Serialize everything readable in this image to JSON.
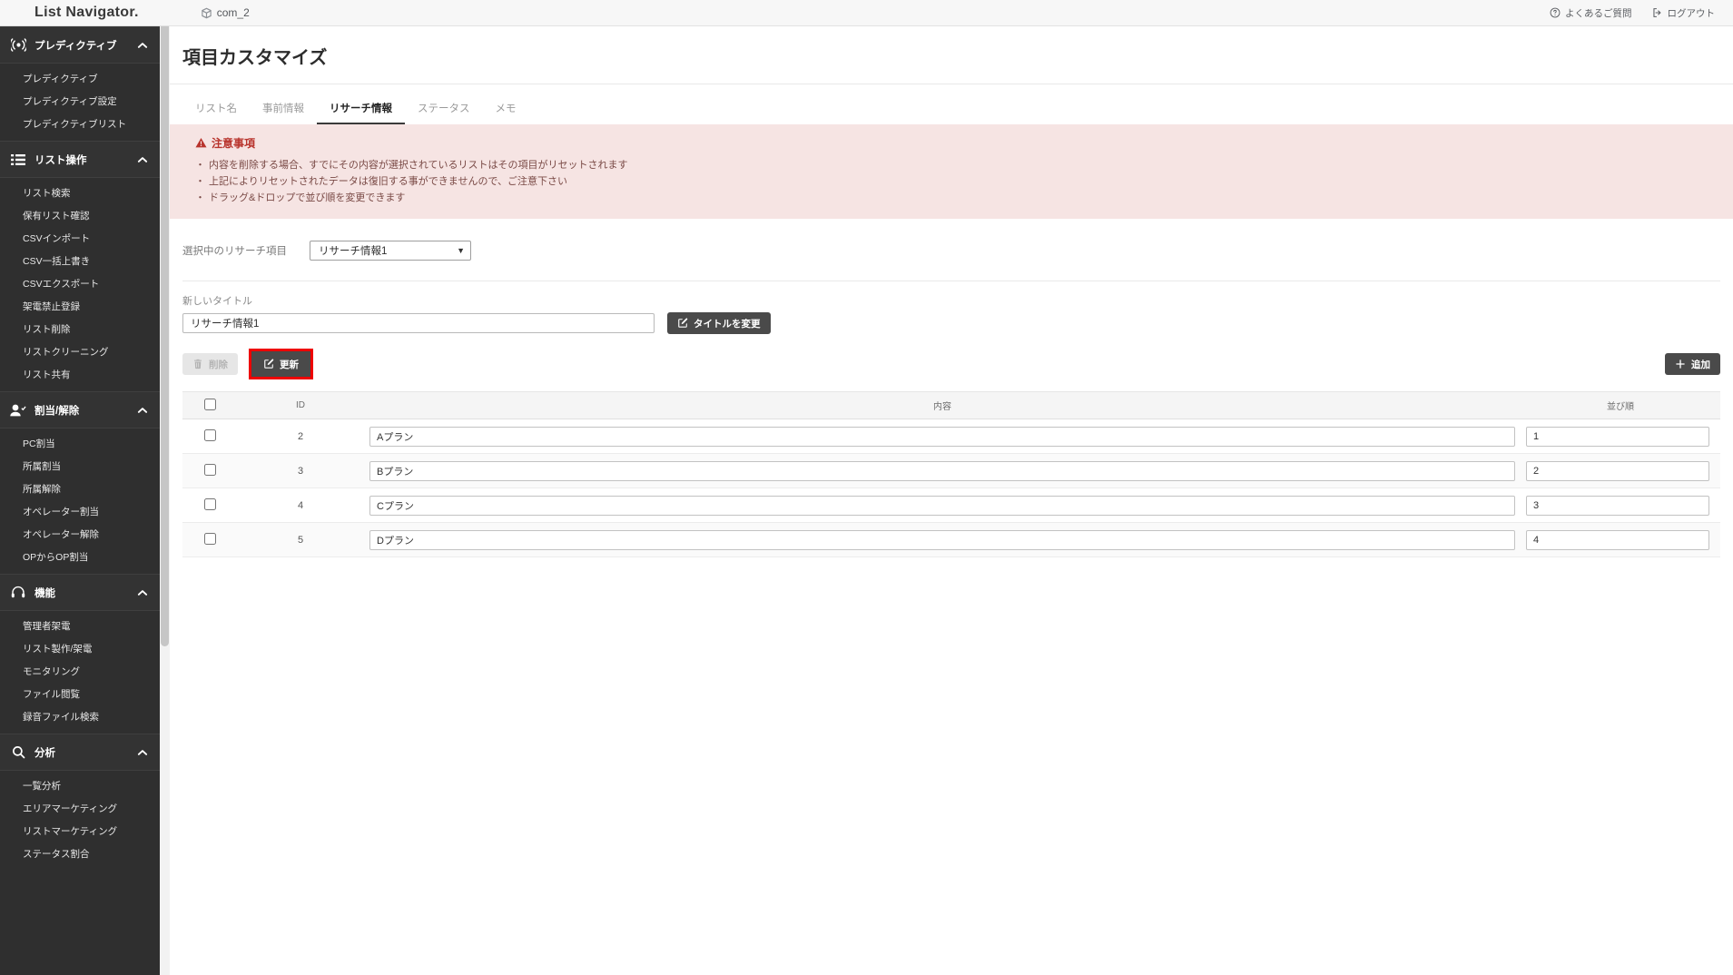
{
  "topbar": {
    "brand": "List Navigator.",
    "company": "com_2",
    "company_icon": "cube-icon",
    "links": [
      {
        "label": "よくあるご質問",
        "icon": "question-circle-icon"
      },
      {
        "label": "ログアウト",
        "icon": "logout-icon"
      }
    ]
  },
  "sidebar": {
    "groups": [
      {
        "label": "プレディクティブ",
        "icon": "broadcast-icon",
        "chevron": "chevron-up-icon",
        "items": [
          "プレディクティブ",
          "プレディクティブ設定",
          "プレディクティブリスト"
        ]
      },
      {
        "label": "リスト操作",
        "icon": "list-icon",
        "chevron": "chevron-up-icon",
        "items": [
          "リスト検索",
          "保有リスト確認",
          "CSVインポート",
          "CSV一括上書き",
          "CSVエクスポート",
          "架電禁止登録",
          "リスト削除",
          "リストクリーニング",
          "リスト共有"
        ]
      },
      {
        "label": "割当/解除",
        "icon": "user-check-icon",
        "chevron": "chevron-up-icon",
        "items": [
          "PC割当",
          "所属割当",
          "所属解除",
          "オペレーター割当",
          "オペレーター解除",
          "OPからOP割当"
        ]
      },
      {
        "label": "機能",
        "icon": "headset-icon",
        "chevron": "chevron-up-icon",
        "items": [
          "管理者架電",
          "リスト製作/架電",
          "モニタリング",
          "ファイル閲覧",
          "録音ファイル検索"
        ]
      },
      {
        "label": "分析",
        "icon": "search-icon",
        "chevron": "chevron-up-icon",
        "items": [
          "一覧分析",
          "エリアマーケティング",
          "リストマーケティング",
          "ステータス割合"
        ]
      }
    ]
  },
  "main": {
    "page_title": "項目カスタマイズ",
    "tabs": [
      {
        "label": "リスト名",
        "active": false
      },
      {
        "label": "事前情報",
        "active": false
      },
      {
        "label": "リサーチ情報",
        "active": true
      },
      {
        "label": "ステータス",
        "active": false
      },
      {
        "label": "メモ",
        "active": false
      }
    ],
    "notice": {
      "icon": "warning-triangle-icon",
      "title": "注意事項",
      "lines": [
        "内容を削除する場合、すでにその内容が選択されているリストはその項目がリセットされます",
        "上記によりリセットされたデータは復旧する事ができませんので、ご注意下さい",
        "ドラッグ&ドロップで並び順を変更できます"
      ]
    },
    "select_row": {
      "label": "選択中のリサーチ項目",
      "selected": "リサーチ情報1",
      "caret_icon": "chevron-down-icon",
      "options": [
        "リサーチ情報1"
      ]
    },
    "title_block": {
      "label": "新しいタイトル",
      "value": "リサーチ情報1",
      "placeholder": "",
      "change_button": {
        "label": "タイトルを変更",
        "icon": "edit-square-icon"
      }
    },
    "actions": {
      "delete": {
        "label": "削除",
        "icon": "trash-icon",
        "disabled": true
      },
      "update": {
        "label": "更新",
        "icon": "edit-square-icon",
        "highlighted": true,
        "highlight_color": "#ee0000"
      },
      "add": {
        "label": "追加",
        "icon": "plus-icon"
      }
    },
    "table": {
      "headers": [
        "",
        "ID",
        "内容",
        "並び順"
      ],
      "rows": [
        {
          "checked": false,
          "id": "2",
          "content": "Aプラン",
          "order": "1"
        },
        {
          "checked": false,
          "id": "3",
          "content": "Bプラン",
          "order": "2"
        },
        {
          "checked": false,
          "id": "4",
          "content": "Cプラン",
          "order": "3"
        },
        {
          "checked": false,
          "id": "5",
          "content": "Dプラン",
          "order": "4"
        }
      ]
    }
  },
  "colors": {
    "sidebar_bg": "#2f2f2f",
    "notice_bg": "#f6e4e3",
    "notice_accent": "#b8332c",
    "button_dark": "#4a4a4a",
    "highlight": "#ee0000"
  }
}
